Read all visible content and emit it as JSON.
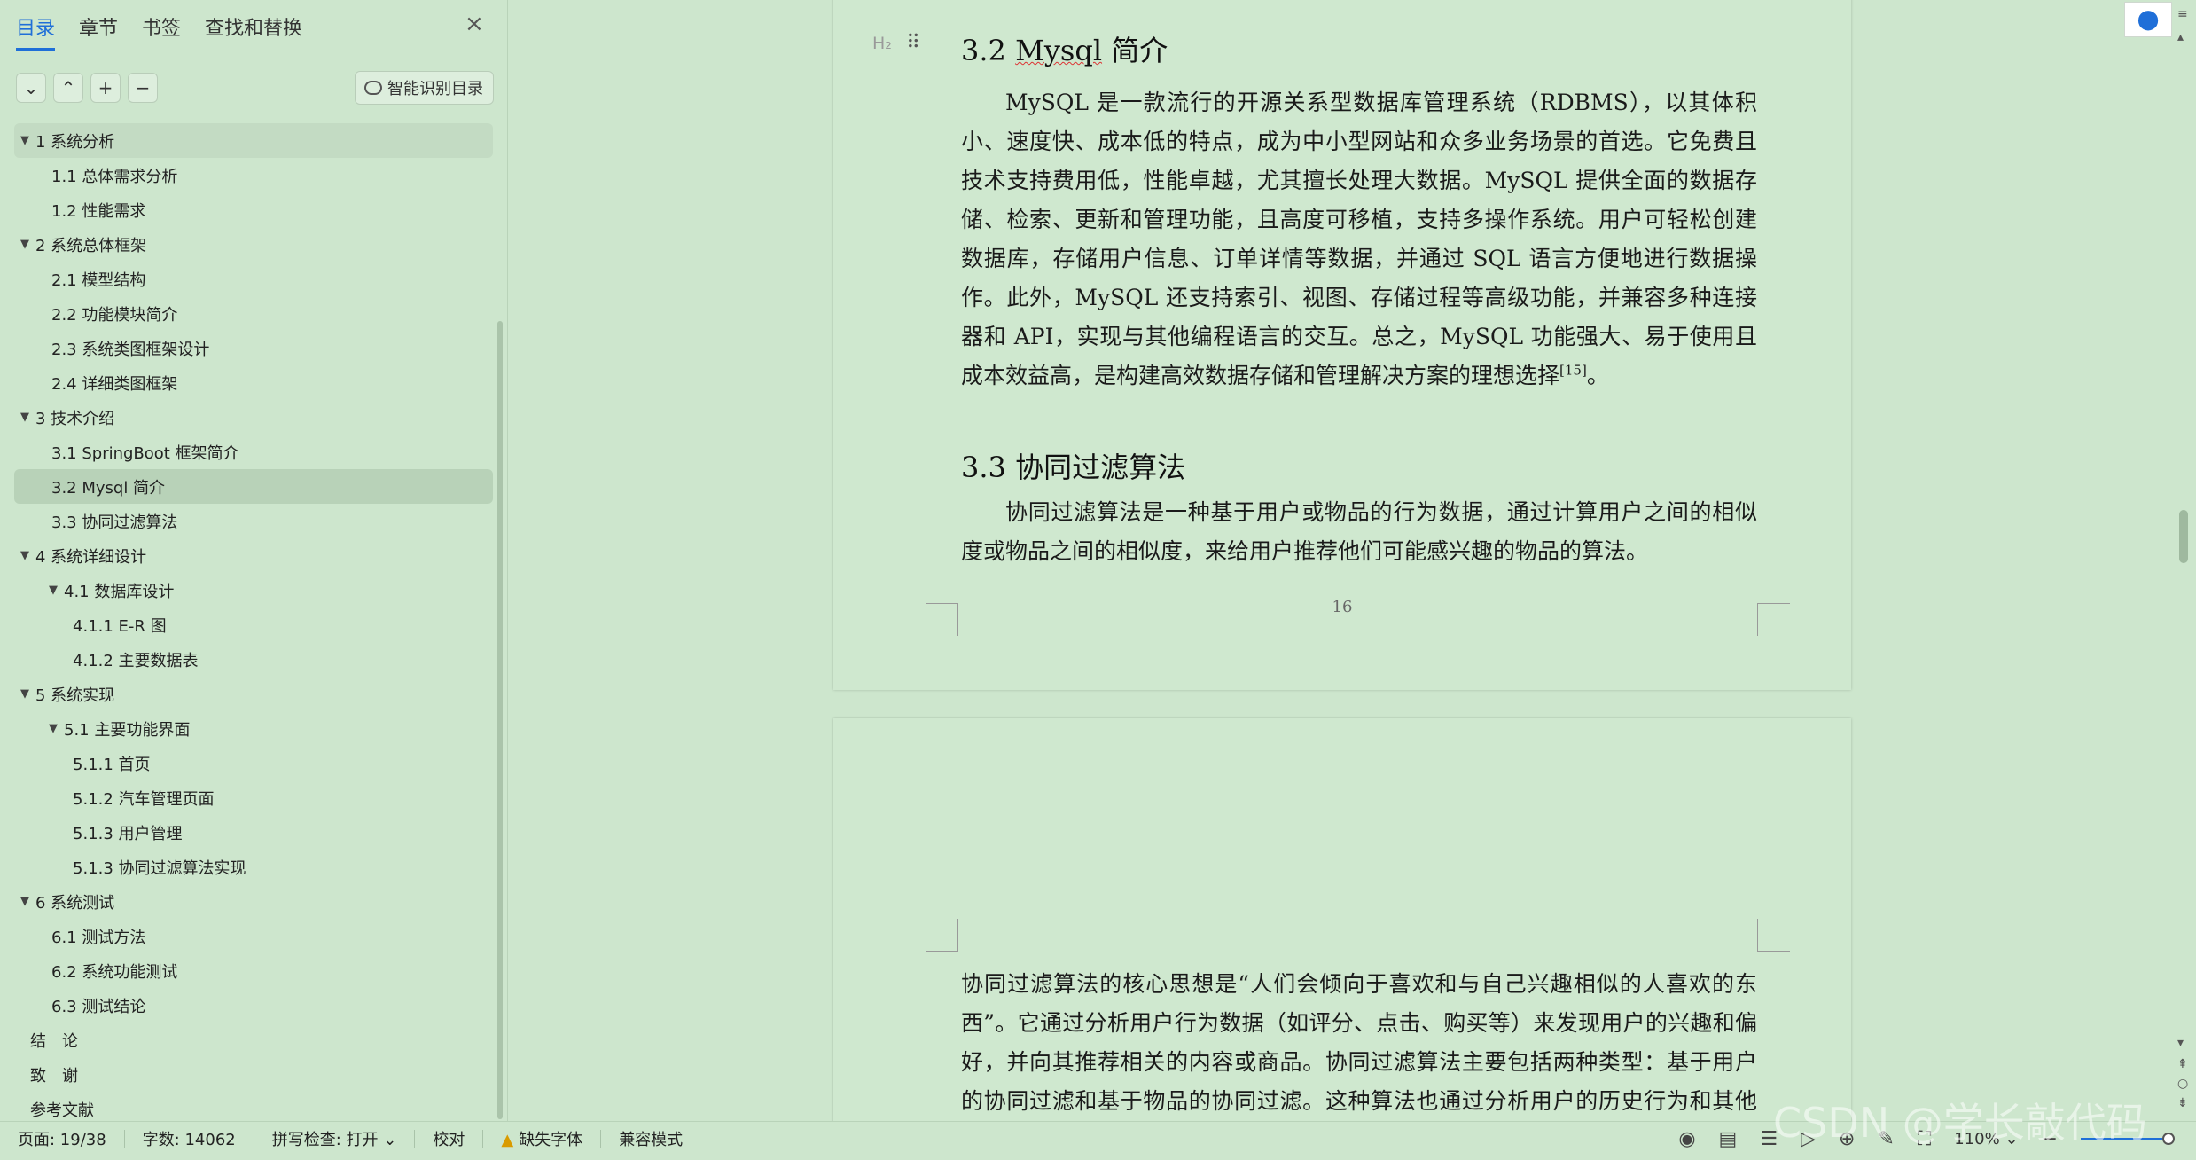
{
  "sidebar": {
    "tabs": [
      {
        "label": "目录",
        "active": true
      },
      {
        "label": "章节",
        "active": false
      },
      {
        "label": "书签",
        "active": false
      },
      {
        "label": "查找和替换",
        "active": false
      }
    ],
    "close_icon": "×",
    "toolbar": {
      "collapse_icon": "⌄",
      "expand_icon": "⌃",
      "add_icon": "+",
      "remove_icon": "−",
      "smart_label": "智能识别目录"
    },
    "toc": [
      {
        "label": "1 系统分析",
        "level": 0,
        "expanded": true
      },
      {
        "label": "1.1 总体需求分析",
        "level": 1
      },
      {
        "label": "1.2 性能需求",
        "level": 1
      },
      {
        "label": "2 系统总体框架",
        "level": 0,
        "expanded": true
      },
      {
        "label": "2.1 模型结构",
        "level": 1
      },
      {
        "label": "2.2 功能模块简介",
        "level": 1
      },
      {
        "label": "2.3 系统类图框架设计",
        "level": 1
      },
      {
        "label": "2.4 详细类图框架",
        "level": 1
      },
      {
        "label": "3 技术介绍",
        "level": 0,
        "expanded": true
      },
      {
        "label": "3.1 SpringBoot 框架简介",
        "level": 1
      },
      {
        "label": "3.2 Mysql 简介",
        "level": 1,
        "selected": true
      },
      {
        "label": "3.3 协同过滤算法",
        "level": 1
      },
      {
        "label": "4 系统详细设计",
        "level": 0,
        "expanded": true
      },
      {
        "label": "4.1 数据库设计",
        "level": 1,
        "expanded": true
      },
      {
        "label": "4.1.1 E-R 图",
        "level": 2
      },
      {
        "label": "4.1.2 主要数据表",
        "level": 2
      },
      {
        "label": "5 系统实现",
        "level": 0,
        "expanded": true
      },
      {
        "label": "5.1 主要功能界面",
        "level": 1,
        "expanded": true
      },
      {
        "label": "5.1.1 首页",
        "level": 2
      },
      {
        "label": "5.1.2 汽车管理页面",
        "level": 2
      },
      {
        "label": "5.1.3 用户管理",
        "level": 2
      },
      {
        "label": "5.1.3 协同过滤算法实现",
        "level": 2
      },
      {
        "label": "6 系统测试",
        "level": 0,
        "expanded": true
      },
      {
        "label": "6.1 测试方法",
        "level": 1
      },
      {
        "label": "6.2 系统功能测试",
        "level": 1
      },
      {
        "label": "6.3 测试结论",
        "level": 1
      },
      {
        "label": "结　论",
        "level": 0
      },
      {
        "label": "致　谢",
        "level": 0
      },
      {
        "label": "参考文献",
        "level": 0
      }
    ]
  },
  "document": {
    "heading_marker": "H₂",
    "h2_num": "3.2 ",
    "h2_word": "Mysql",
    "h2_rest": " 简介",
    "p1": "MySQL 是一款流行的开源关系型数据库管理系统（RDBMS），以其体积小、速度快、成本低的特点，成为中小型网站和众多业务场景的首选。它免费且技术支持费用低，性能卓越，尤其擅长处理大数据。MySQL 提供全面的数据存储、检索、更新和管理功能，且高度可移植，支持多操作系统。用户可轻松创建数据库，存储用户信息、订单详情等数据，并通过 SQL 语言方便地进行数据操作。此外，MySQL 还支持索引、视图、存储过程等高级功能，并兼容多种连接器和 API，实现与其他编程语言的交互。总之，MySQL 功能强大、易于使用且成本效益高，是构建高效数据存储和管理解决方案的理想选择",
    "p1_cite": "[15]",
    "p1_end": "。",
    "h3": "3.3 协同过滤算法",
    "p2": "协同过滤算法是一种基于用户或物品的行为数据，通过计算用户之间的相似度或物品之间的相似度，来给用户推荐他们可能感兴趣的物品的算法。",
    "page_number": "16",
    "p3": "协同过滤算法的核心思想是“人们会倾向于喜欢和与自己兴趣相似的人喜欢的东西”。它通过分析用户行为数据（如评分、点击、购买等）来发现用户的兴趣和偏好，并向其推荐相关的内容或商品。协同过滤算法主要包括两种类型：基于用户的协同过滤和基于物品的协同过滤。这种算法也通过分析用户的历史行为和其他用户的行为进行比较，以发现用户的兴趣和偏好，并据此"
  },
  "statusbar": {
    "page": "页面: 19/38",
    "words": "字数: 14062",
    "spell": "拼写检查: 打开",
    "proof": "校对",
    "missing_font": "缺失字体",
    "compat": "兼容模式",
    "zoom": "110%"
  },
  "watermark": "CSDN @学长敲代码",
  "colors": {
    "accent": "#1f6fd8",
    "background": "#cde6cd",
    "warning": "#d99b00"
  }
}
